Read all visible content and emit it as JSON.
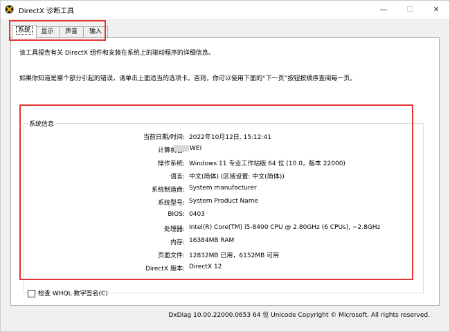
{
  "window": {
    "title": "DirectX 诊断工具",
    "controls": {
      "minimize": "—",
      "maximize": "☐",
      "close": "✕"
    }
  },
  "tabs": [
    {
      "label": "系统",
      "active": true
    },
    {
      "label": "显示",
      "active": false
    },
    {
      "label": "声音",
      "active": false
    },
    {
      "label": "输入",
      "active": false
    }
  ],
  "intro": {
    "line1": "该工具报告有关 DirectX 组件和安装在系统上的驱动程序的详细信息。",
    "line2": "如果你知道是哪个部分引起的错误，请单击上面适当的选项卡。否则，你可以使用下面的“下一页”按钮按顺序查阅每一页。"
  },
  "system_info": {
    "group_title": "系统信息",
    "rows": [
      {
        "label": "当前日期/时间:",
        "value": "2022年10月12日, 15:12:41"
      },
      {
        "label": "计算机名:",
        "value": "WEI"
      },
      {
        "label": "操作系统:",
        "value": "Windows 11 专业工作站版 64 位 (10.0，版本 22000)"
      },
      {
        "label": "语言:",
        "value": "中文(简体) (区域设置: 中文(简体))"
      },
      {
        "label": "系统制造商:",
        "value": "System manufacturer"
      },
      {
        "label": "系统型号:",
        "value": "System Product Name"
      },
      {
        "label": "BIOS:",
        "value": "0403"
      },
      {
        "label": "处理器:",
        "value": "Intel(R) Core(TM) i5-8400 CPU @ 2.80GHz (6 CPUs), ~2.8GHz"
      },
      {
        "label": "内存:",
        "value": "16384MB RAM"
      },
      {
        "label": "页面文件:",
        "value": "12832MB 已用，6152MB 可用"
      },
      {
        "label": "DirectX 版本:",
        "value": "DirectX 12"
      }
    ]
  },
  "whql_checkbox": {
    "label": "检查 WHQL 数字签名(C)",
    "checked": false
  },
  "footer": {
    "text": "DxDiag 10.00.22000.0653 64 位 Unicode  Copyright © Microsoft. All rights reserved."
  },
  "colors": {
    "highlight_box": "#e53333",
    "window_bg": "#f0f0f0",
    "panel_bg": "#ffffff"
  }
}
